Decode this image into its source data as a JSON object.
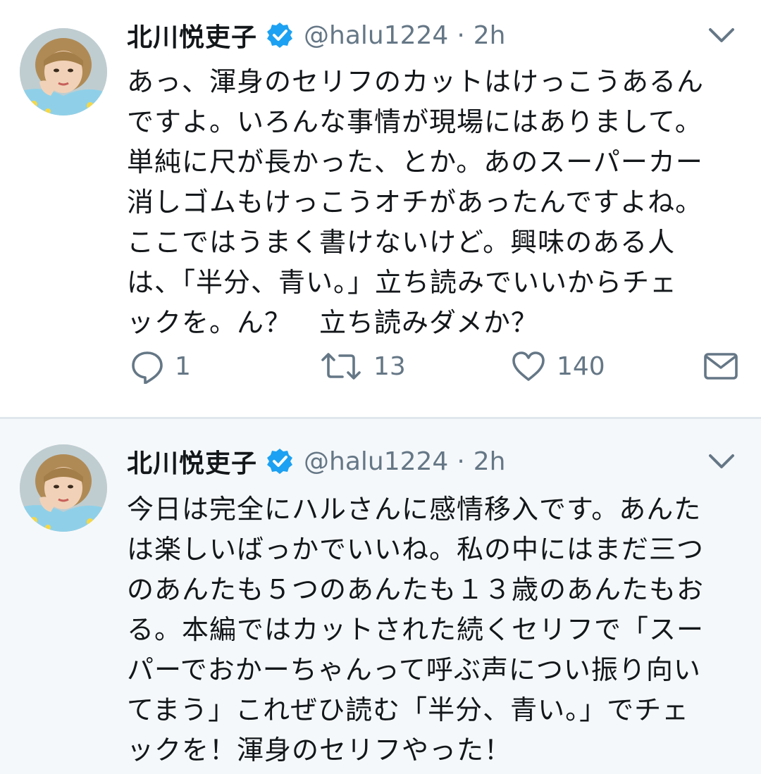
{
  "tweets": [
    {
      "author": {
        "name": "北川悦吏子",
        "handle": "@halu1224",
        "separator": "·",
        "time": "2h"
      },
      "body": "あっ、渾身のセリフのカットはけっこうあるん\nですよ。いろんな事情が現場にはありまして。\n単純に尺が長かった、とか。あのスーパーカー\n消しゴムもけっこうオチがあったんですよね。\nここではうまく書けないけど。興味のある人\nは、「半分、青い。」立ち読みでいいからチェ\nックを。ん？　立ち読みダメか？",
      "actions": {
        "reply_count": "1",
        "retweet_count": "13",
        "like_count": "140"
      }
    },
    {
      "author": {
        "name": "北川悦吏子",
        "handle": "@halu1224",
        "separator": "·",
        "time": "2h"
      },
      "body": "今日は完全にハルさんに感情移入です。あんた\nは楽しいばっかでいいね。私の中にはまだ三つ\nのあんたも５つのあんたも１３歳のあんたもお\nる。本編ではカットされた続くセリフで「スー\nパーでおかーちゃんって呼ぶ声につい振り向い\nてまう」これぜひ読む「半分、青い。」でチェ\nックを！渾身のセリフやった！"
    }
  ],
  "icons": {
    "verified": "verified-badge-icon",
    "more": "chevron-down-icon",
    "reply": "reply-bubble-icon",
    "retweet": "retweet-icon",
    "like": "heart-icon",
    "dm": "envelope-icon"
  },
  "colors": {
    "text": "#14171a",
    "secondary": "#657786",
    "verified": "#1da1f2",
    "thread_background": "#f5f8fa",
    "divider": "#e1e8ed"
  }
}
